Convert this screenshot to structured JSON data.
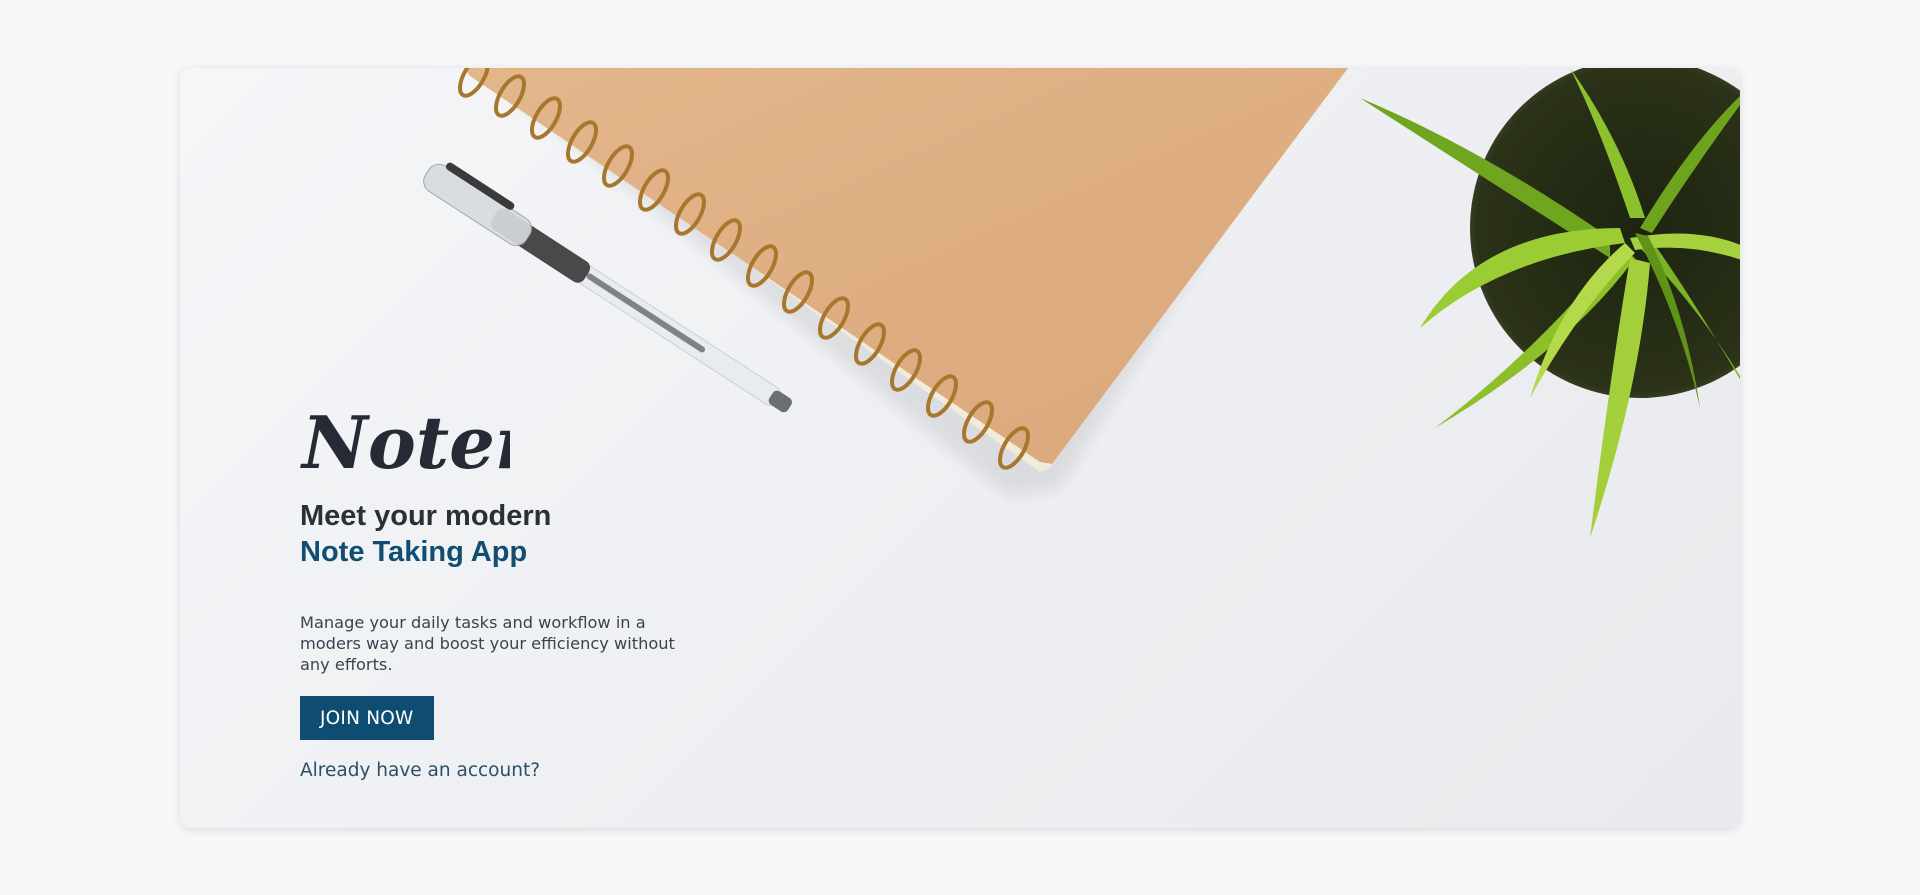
{
  "hero": {
    "logo_text": "Noter",
    "headline_line1": "Meet your modern",
    "headline_line2": "Note Taking App",
    "description": "Manage your daily tasks and workflow in a moders way and boost your efficiency without any efforts.",
    "cta_label": "JOIN NOW",
    "login_link": "Already have an account?"
  },
  "colors": {
    "background": "#f7f8fa",
    "accent": "#114e72",
    "button": "#0f4c72",
    "heading": "#2a2f38",
    "body_text": "#3b4250"
  },
  "decoration": {
    "image": "desk-flatlay-photo"
  }
}
